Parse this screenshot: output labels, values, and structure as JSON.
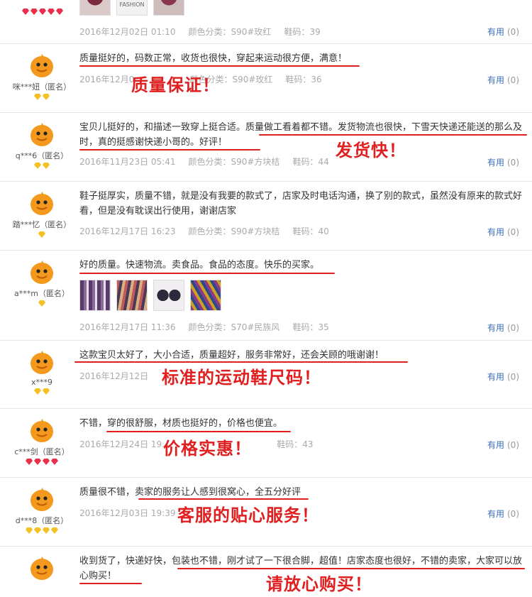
{
  "review_0": {
    "badges": "red",
    "thumbs": [
      "thumb-shoe-red",
      "thumb-fashion-label",
      "thumb-shoe-pink"
    ],
    "thumb_label": "FASHION",
    "date": "2016年12月02日 01:10",
    "color": "颜色分类：S90#玫红",
    "size": "鞋码：39",
    "useful": "有用",
    "count": "(0)"
  },
  "reviews": [
    {
      "user": "咪***妞（匿名）",
      "badges": [
        "yellow",
        "yellow"
      ],
      "text": "质量挺好的，码数正常，收货也很快，穿起来运动很方便，满意！",
      "date": "2016年12月0",
      "color": "颜色分类：S90#玫红",
      "size": "鞋码：36",
      "useful": "有用",
      "count": "(0)",
      "stamp": "质量保证！"
    },
    {
      "user": "q***6（匿名）",
      "badges": [
        "yellow",
        "yellow"
      ],
      "text": "宝贝儿挺好的，和描述一致穿上挺合适。质量做工看着都不错。发货物流也很快，下雪天快递还能送的那么及时，真的挺感谢快递小哥的。好评！",
      "date": "2016年11月23日 05:41",
      "color": "颜色分类：S90#方块桔",
      "size": "鞋码：44",
      "useful": "有用",
      "count": "(0)",
      "stamp": "发货快！"
    },
    {
      "user": "踏***忆（匿名）",
      "badges": [
        "yellow"
      ],
      "text": "鞋子挺厚实，质量不错，就是没有我要的款式了，店家及时电话沟通，换了别的款式，虽然没有原来的款式好看，但是没有耽误出行使用，谢谢店家",
      "date": "2016年12月17日 16:23",
      "color": "颜色分类：S90#方块桔",
      "size": "鞋码：40",
      "useful": "有用",
      "count": "(0)",
      "stamp": ""
    },
    {
      "user": "a***m（匿名）",
      "badges": [
        "yellow"
      ],
      "text": "好的质量。快速物流。卖食品。食品的态度。快乐的买家。",
      "date": "2016年12月17日 11:36",
      "color": "颜色分类：S70#民族风",
      "size": "鞋码：35",
      "useful": "有用",
      "count": "(0)",
      "stamp": ""
    },
    {
      "user": "x***9",
      "badges": [
        "yellow",
        "yellow"
      ],
      "text": "这款宝贝太好了，大小合适，质量超好，服务非常好，还会关顾的哦谢谢！",
      "date": "2016年12月12日",
      "color": "",
      "size": "",
      "useful": "有用",
      "count": "(0)",
      "stamp": "标准的运动鞋尺码！"
    },
    {
      "user": "c***剑（匿名）",
      "badges": [
        "red",
        "red",
        "red",
        "red"
      ],
      "text": "不错，穿的很舒服，材质也挺好的，价格也便宜。",
      "date": "2016年12月24日 19:",
      "color": "",
      "size": "鞋码：43",
      "useful": "有用",
      "count": "(0)",
      "stamp": "价格实惠！"
    },
    {
      "user": "d***8（匿名）",
      "badges": [
        "yellow",
        "yellow",
        "yellow",
        "yellow"
      ],
      "text": "质量很不错，卖家的服务让人感到很窝心，全五分好评",
      "date": "2016年12月03日 19:39",
      "color": "",
      "size": "",
      "useful": "有用",
      "count": "(0)",
      "stamp": "客服的贴心服务！"
    },
    {
      "user": "",
      "badges": [],
      "text": "收到货了，快递好快，包装也不错，刚才试了一下很合脚，超值！店家态度也很好，不错的卖家，大家可以放心购买！",
      "date": "",
      "color": "",
      "size": "",
      "useful": "",
      "count": "",
      "stamp": "请放心购买！"
    }
  ],
  "colors": {
    "stamp_red": "#e02020",
    "link_blue": "#3a6fb7",
    "avatar_orange": "#f39a1e",
    "meta_gray": "#aaaaaa"
  }
}
